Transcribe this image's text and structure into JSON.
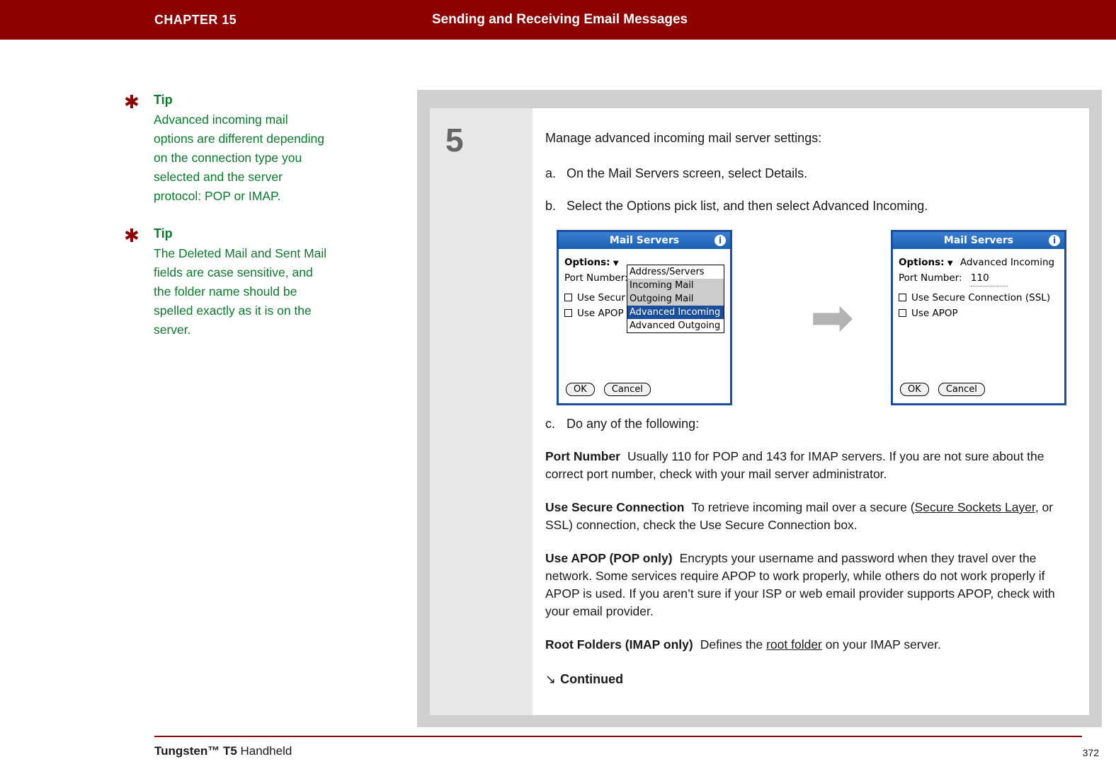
{
  "header": {
    "chapter": "CHAPTER 15",
    "title": "Sending and Receiving Email Messages",
    "bg_color": "#8c0000"
  },
  "tips": [
    {
      "label": "Tip",
      "text": "Advanced incoming mail options are different depending on the connection type you selected and the server protocol: POP or IMAP.",
      "color": "#0c7a2e",
      "icon": "asterisk-icon"
    },
    {
      "label": "Tip",
      "text": "The Deleted Mail and Sent Mail fields are case sensitive, and the folder name should be spelled exactly as it is on the server.",
      "color": "#0c7a2e",
      "icon": "asterisk-icon"
    }
  ],
  "step": {
    "number": "5",
    "lead": "Manage advanced incoming mail server settings:",
    "items": [
      {
        "marker": "a.",
        "text": "On the Mail Servers screen, select Details."
      },
      {
        "marker": "b.",
        "text": "Select the Options pick list, and then select Advanced Incoming."
      },
      {
        "marker": "c.",
        "text": "Do any of the following:"
      }
    ]
  },
  "figures": {
    "arrow": "➡",
    "left_screen": {
      "title": "Mail Servers",
      "info_icon": "i",
      "options_label": "Options:",
      "options_value": "",
      "port_label": "Port Number:",
      "port_value": "",
      "checkbox1": "Use Secure Connection (SSL)",
      "checkbox2": "Use APOP",
      "picklist": [
        {
          "label": "Address/Servers",
          "state": "normal"
        },
        {
          "label": "Incoming Mail",
          "state": "shade"
        },
        {
          "label": "Outgoing Mail",
          "state": "shade"
        },
        {
          "label": "Advanced Incoming",
          "state": "selected"
        },
        {
          "label": "Advanced Outgoing",
          "state": "normal"
        }
      ],
      "ok": "OK",
      "cancel": "Cancel"
    },
    "right_screen": {
      "title": "Mail Servers",
      "info_icon": "i",
      "options_label": "Options:",
      "options_value": "Advanced Incoming",
      "port_label": "Port Number:",
      "port_value": "110",
      "checkbox1": "Use Secure Connection (SSL)",
      "checkbox2": "Use APOP",
      "ok": "OK",
      "cancel": "Cancel"
    }
  },
  "definitions": [
    {
      "term": "Port Number",
      "body_1": "Usually 110 for POP and 143 for IMAP servers. If you are not sure about the correct port number, check with your mail server administrator.",
      "link": "",
      "body_2": ""
    },
    {
      "term": "Use Secure Connection",
      "body_1": "To retrieve incoming mail over a secure (",
      "link": "Secure Sockets Layer",
      "body_2": ", or SSL) connection, check the Use Secure Connection box."
    },
    {
      "term": "Use APOP (POP only)",
      "body_1": "Encrypts your username and password when they travel over the network. Some services require APOP to work properly, while others do not work properly if APOP is used. If you aren’t sure if your ISP or web email provider supports APOP, check with your email provider.",
      "link": "",
      "body_2": ""
    },
    {
      "term": "Root Folders (IMAP only)",
      "body_1": "Defines the ",
      "link": "root folder",
      "body_2": " on your IMAP server."
    }
  ],
  "continued": {
    "arrow": "↘",
    "label": "Continued"
  },
  "footer": {
    "product": "Tungsten™ T5",
    "product_suffix": " Handheld",
    "page": "372"
  }
}
